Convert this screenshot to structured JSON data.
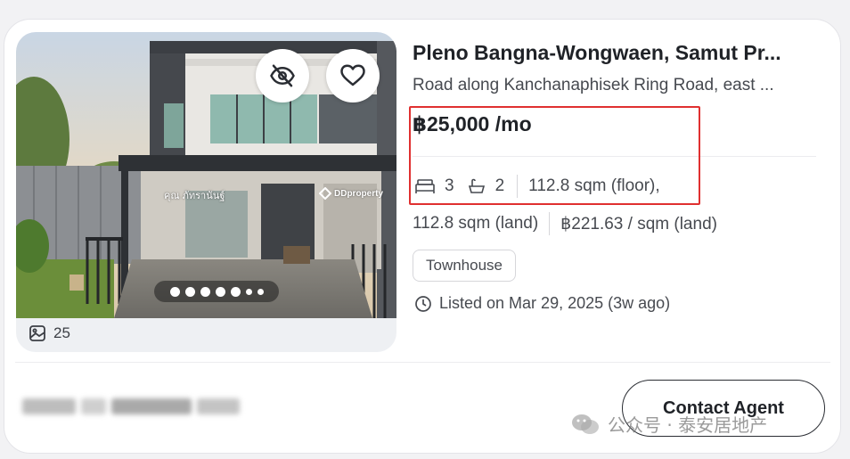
{
  "listing": {
    "title": "Pleno Bangna-Wongwaen, Samut Pr...",
    "address": "Road along Kanchanaphisek Ring Road, east ...",
    "price": "฿25,000 /mo",
    "bedrooms": "3",
    "bathrooms": "2",
    "floor_area": "112.8 sqm (floor),",
    "land_area": "112.8 sqm (land)",
    "price_per_sqm": "฿221.63 / sqm (land)",
    "property_type": "Townhouse",
    "listed_text": "Listed on Mar 29, 2025 (3w ago)"
  },
  "gallery": {
    "photo_count": "25",
    "watermark": "DDproperty",
    "sign_text": "คุณ ภัทรานันฐ์",
    "carousel_dots": 7,
    "active_dot": 0
  },
  "actions": {
    "contact_label": "Contact Agent",
    "hide_icon": "eye-off-icon",
    "favorite_icon": "heart-icon"
  },
  "overlay": {
    "wechat_text": "公众号 · 泰安居地产"
  },
  "colors": {
    "highlight_border": "#e03030",
    "card_bg": "#ffffff",
    "text_primary": "#1f2227"
  }
}
